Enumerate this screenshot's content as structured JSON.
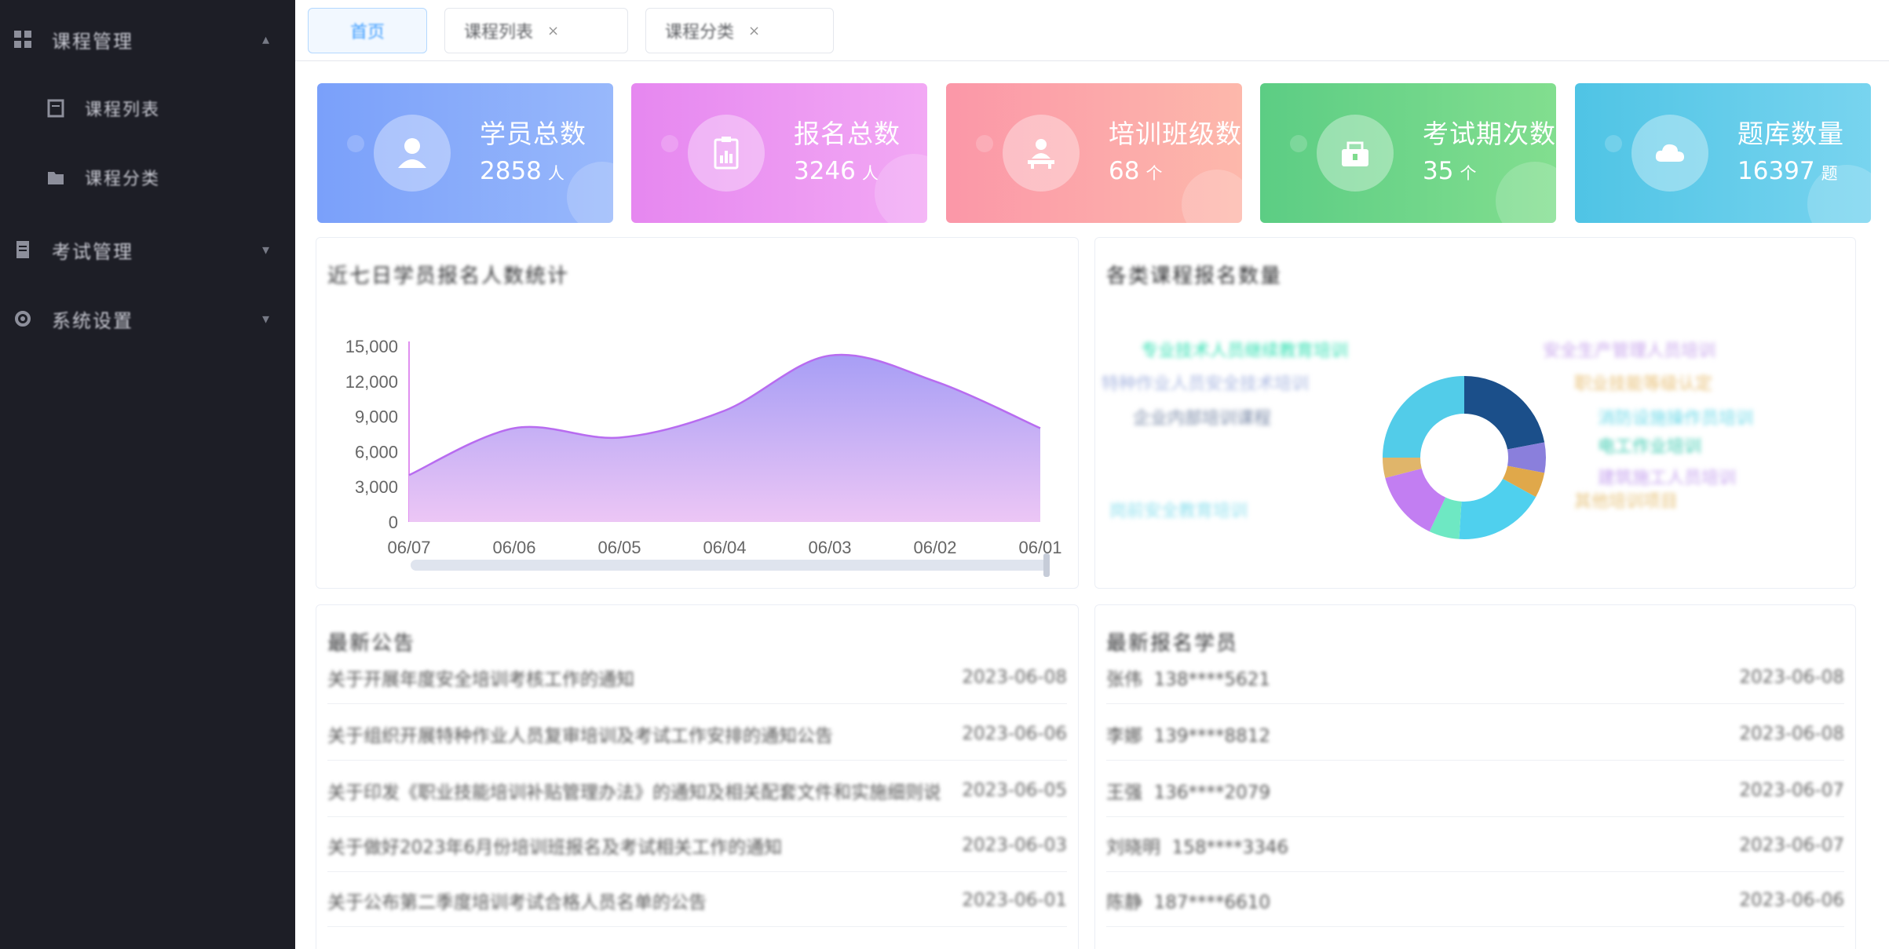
{
  "sidebar": {
    "items": [
      {
        "label": "课程管理",
        "icon": "grid-icon"
      },
      {
        "label": "课程列表",
        "icon": "book-icon"
      },
      {
        "label": "课程分类",
        "icon": "folder-icon"
      },
      {
        "label": "考试管理",
        "icon": "document-icon"
      },
      {
        "label": "系统设置",
        "icon": "gear-icon"
      }
    ]
  },
  "tabs": [
    {
      "label": "首页",
      "active": true
    },
    {
      "label": "课程列表",
      "close": "×"
    },
    {
      "label": "课程分类",
      "close": "×"
    }
  ],
  "stats": [
    {
      "title": "学员总数",
      "value": "2858",
      "unit": "人",
      "icon": "user-icon",
      "color_from": "#7fa3fb",
      "color_to": "#93b4fb"
    },
    {
      "title": "报名总数",
      "value": "3246",
      "unit": "人",
      "icon": "clipboard-icon",
      "color_from": "#e58af0",
      "color_to": "#f0a3f3"
    },
    {
      "title": "培训班级数",
      "value": "68",
      "unit": "个",
      "icon": "class-icon",
      "color_from": "#fb9aa6",
      "color_to": "#fdb4ad"
    },
    {
      "title": "考试期次数",
      "value": "35",
      "unit": "个",
      "icon": "exam-icon",
      "color_from": "#5fcf86",
      "color_to": "#7fdc8e"
    },
    {
      "title": "题库数量",
      "value": "16397",
      "unit": "题",
      "icon": "cloud-icon",
      "color_from": "#53c6e6",
      "color_to": "#74d3ee"
    }
  ],
  "panels": {
    "trend_title": "近七日学员报名人数统计",
    "pie_title": "各类课程报名数量",
    "notice_title": "最新公告",
    "latest_title": "最新报名学员"
  },
  "chart_data": {
    "type": "area",
    "x": [
      "06/07",
      "06/06",
      "06/05",
      "06/04",
      "06/03",
      "06/02",
      "06/01"
    ],
    "y_ticks": [
      "15,000",
      "12,000",
      "9,000",
      "6,000",
      "3,000",
      "0"
    ],
    "ylim": [
      0,
      15000
    ],
    "series": [
      {
        "values": [
          4000,
          8000,
          7200,
          9500,
          14200,
          12000,
          8000
        ],
        "color": "#b86cf0"
      }
    ]
  },
  "donut": {
    "segments": [
      {
        "value": 22,
        "color": "#1b4f8a"
      },
      {
        "value": 6,
        "color": "#8a7fdc"
      },
      {
        "value": 5,
        "color": "#e0a84a"
      },
      {
        "value": 18,
        "color": "#4fd0ee"
      },
      {
        "value": 6,
        "color": "#6ee8c3"
      },
      {
        "value": 14,
        "color": "#c27ef2"
      },
      {
        "value": 4,
        "color": "#e0b56a"
      },
      {
        "value": 25,
        "color": "#52cce9"
      }
    ],
    "labels": [
      {
        "text": "专业技术人员继续教育培训",
        "color": "#33e0b3"
      },
      {
        "text": "安全生产管理人员培训",
        "color": "#c8a6ec"
      },
      {
        "text": "特种作业人员安全技术培训",
        "color": "#a8b6e0"
      },
      {
        "text": "职业技能等级认定",
        "color": "#e8c078"
      },
      {
        "text": "企业内部培训课程",
        "color": "#7a8aa8"
      },
      {
        "text": "消防设施操作员培训",
        "color": "#6ed9e8"
      },
      {
        "text": "电工作业培训",
        "color": "#3ccab0"
      },
      {
        "text": "建筑施工人员培训",
        "color": "#c5a2ee"
      },
      {
        "text": "其他培训项目",
        "color": "#e6c27a"
      },
      {
        "text": "岗前安全教育培训",
        "color": "#8fe0ee"
      }
    ]
  },
  "notices": [
    {
      "title": "关于开展年度安全培训考核工作的通知",
      "date": "2023-06-08"
    },
    {
      "title": "关于组织开展特种作业人员复审培训及考试工作安排的通知公告",
      "date": "2023-06-06"
    },
    {
      "title": "关于印发《职业技能培训补贴管理办法》的通知及相关配套文件和实施细则说明",
      "date": "2023-06-05"
    },
    {
      "title": "关于做好2023年6月份培训班报名及考试相关工作的通知",
      "date": "2023-06-03"
    },
    {
      "title": "关于公布第二季度培训考试合格人员名单的公告",
      "date": "2023-06-01"
    }
  ],
  "latest": [
    {
      "name": "张伟",
      "phone": "138****5621",
      "date": "2023-06-08"
    },
    {
      "name": "李娜",
      "phone": "139****8812",
      "date": "2023-06-08"
    },
    {
      "name": "王强",
      "phone": "136****2079",
      "date": "2023-06-07"
    },
    {
      "name": "刘晓明",
      "phone": "158****3346",
      "date": "2023-06-07"
    },
    {
      "name": "陈静",
      "phone": "187****6610",
      "date": "2023-06-06"
    }
  ]
}
